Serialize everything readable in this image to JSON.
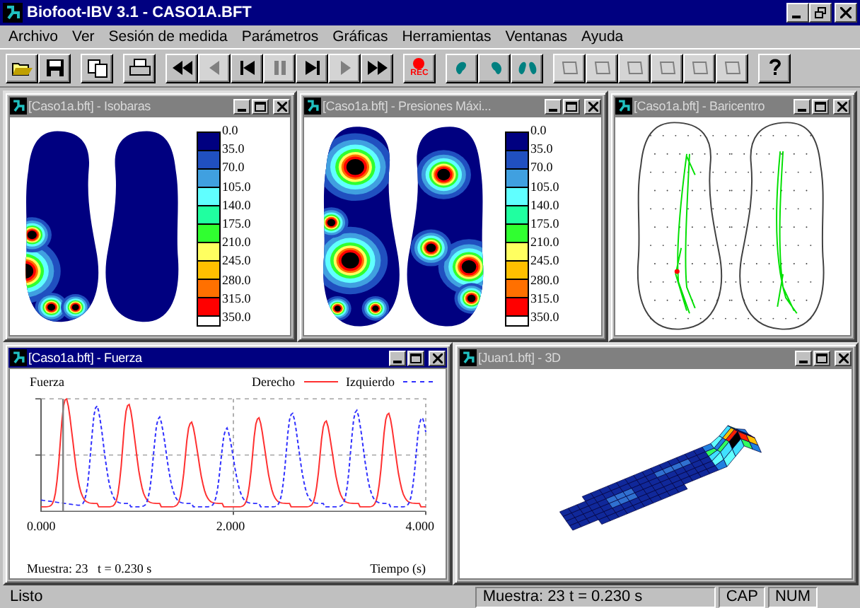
{
  "window": {
    "title": "Biofoot-IBV 3.1 - CASO1A.BFT"
  },
  "menu": [
    {
      "label": "Archivo"
    },
    {
      "label": "Ver"
    },
    {
      "label": "Sesión de medida"
    },
    {
      "label": "Parámetros"
    },
    {
      "label": "Gráficas"
    },
    {
      "label": "Herramientas"
    },
    {
      "label": "Ventanas"
    },
    {
      "label": "Ayuda"
    }
  ],
  "toolbar": [
    [
      {
        "kind": "open",
        "disabled": false
      },
      {
        "kind": "save",
        "disabled": false
      }
    ],
    [
      {
        "kind": "copy",
        "disabled": false
      }
    ],
    [
      {
        "kind": "print",
        "disabled": false
      }
    ],
    [
      {
        "kind": "rewind",
        "disabled": false
      },
      {
        "kind": "prev",
        "disabled": true
      },
      {
        "kind": "first",
        "disabled": false
      },
      {
        "kind": "pause",
        "disabled": true
      },
      {
        "kind": "last",
        "disabled": false
      },
      {
        "kind": "next",
        "disabled": true
      },
      {
        "kind": "forward",
        "disabled": false
      }
    ],
    [
      {
        "kind": "rec",
        "disabled": false,
        "label": "REC"
      }
    ],
    [
      {
        "kind": "foot-left",
        "disabled": false
      },
      {
        "kind": "foot-right",
        "disabled": false
      },
      {
        "kind": "feet",
        "disabled": false
      }
    ],
    [
      {
        "kind": "tool",
        "disabled": true
      },
      {
        "kind": "tool",
        "disabled": true
      },
      {
        "kind": "tool",
        "disabled": true
      },
      {
        "kind": "tool",
        "disabled": true
      },
      {
        "kind": "tool",
        "disabled": true
      },
      {
        "kind": "tool",
        "disabled": true
      }
    ],
    [
      {
        "kind": "help",
        "disabled": false
      }
    ]
  ],
  "windows": [
    [
      {
        "kind": "isobar",
        "title": "[Caso1a.bft] - Isobaras",
        "active": false,
        "scale": {
          "labels": [
            "0.0",
            "35.0",
            "70.0",
            "105.0",
            "140.0",
            "175.0",
            "210.0",
            "245.0",
            "280.0",
            "315.0",
            "350.0"
          ],
          "bands": [
            {
              "color": "#000080"
            },
            {
              "color": "#2050c0"
            },
            {
              "color": "#40a0e0"
            },
            {
              "color": "#60ffff"
            },
            {
              "color": "#20ffa0"
            },
            {
              "color": "#30ff30"
            },
            {
              "color": "#ffff60"
            },
            {
              "color": "#ffc000"
            },
            {
              "color": "#ff7000"
            },
            {
              "color": "#ff0000"
            }
          ]
        }
      },
      {
        "kind": "peak",
        "title": "[Caso1a.bft] - Presiones Máxi...",
        "active": false,
        "scale": {
          "labels": [
            "0.0",
            "35.0",
            "70.0",
            "105.0",
            "140.0",
            "175.0",
            "210.0",
            "245.0",
            "280.0",
            "315.0",
            "350.0"
          ],
          "bands": [
            {
              "color": "#000080"
            },
            {
              "color": "#2050c0"
            },
            {
              "color": "#40a0e0"
            },
            {
              "color": "#60ffff"
            },
            {
              "color": "#20ffa0"
            },
            {
              "color": "#30ff30"
            },
            {
              "color": "#ffff60"
            },
            {
              "color": "#ffc000"
            },
            {
              "color": "#ff7000"
            },
            {
              "color": "#ff0000"
            }
          ]
        }
      },
      {
        "kind": "centre",
        "title": "[Caso1a.bft] - Baricentro",
        "active": false
      }
    ],
    [
      {
        "kind": "force",
        "title": "[Caso1a.bft] - Fuerza",
        "active": true,
        "ylabel": "Fuerza",
        "xlabel": "Tiempo (s)",
        "xticks": [
          "0.000",
          "2.000",
          "4.000"
        ],
        "legend": [
          {
            "label": "Derecho",
            "color": "#ff3030"
          },
          {
            "label": "Izquierdo",
            "color": "#3030ff"
          }
        ],
        "readout": "Muestra: 23   t = 0.230 s"
      },
      {
        "kind": "surface",
        "title": "[Juan1.bft] - 3D",
        "active": false
      }
    ]
  ],
  "status_bar": {
    "message": "Listo",
    "sample": "Muestra: 23    t = 0.230 s",
    "indicators": [
      {
        "label": "CAP"
      },
      {
        "label": "NUM"
      }
    ]
  }
}
